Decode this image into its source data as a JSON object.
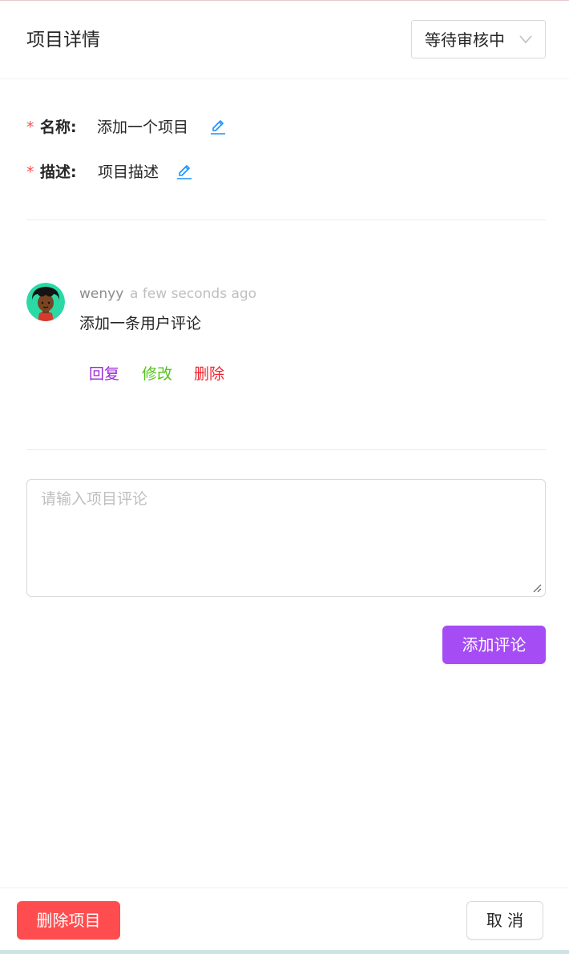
{
  "header": {
    "title": "项目详情",
    "status_select": {
      "selected": "等待审核中",
      "icon": "chevron-down-icon"
    }
  },
  "fields": {
    "name": {
      "required_mark": "*",
      "label": "名称:",
      "value": "添加一个项目",
      "edit_icon": "pencil-icon"
    },
    "description": {
      "required_mark": "*",
      "label": "描述:",
      "value": "项目描述",
      "edit_icon": "pencil-icon"
    }
  },
  "comment": {
    "author": "wenyy",
    "time": "a few seconds ago",
    "content": "添加一条用户评论",
    "actions": {
      "reply": "回复",
      "edit": "修改",
      "delete": "删除"
    }
  },
  "comment_form": {
    "placeholder": "请输入项目评论",
    "value": "",
    "submit_label": "添加评论"
  },
  "footer": {
    "delete_label": "删除项目",
    "cancel_label": "取 消"
  },
  "colors": {
    "primary": "#a54cf5",
    "danger": "#ff4d4f",
    "link": "#1890ff",
    "reply": "#9c27d6",
    "edit": "#52c41a",
    "delete": "#f5222d"
  }
}
